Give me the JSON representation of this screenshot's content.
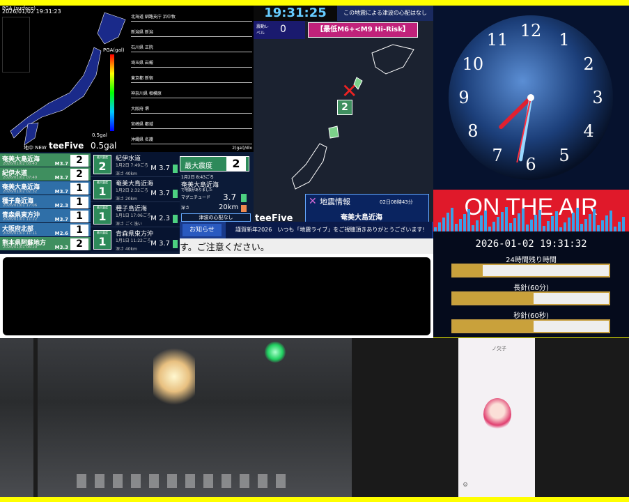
{
  "pga": {
    "title": "PGA (surface)",
    "timestamp": "2026/01/02 19:31:23",
    "scale_label": "PGA(gal)",
    "scale_value": "0.5gal",
    "scale_small": "0.5gal",
    "footer_left": "地中 NEW",
    "brand": "teeFive"
  },
  "waveforms": {
    "stations": [
      "北海道 釧路支庁 浜中牧",
      "新潟県 新潟",
      "石川県 正院",
      "埼玉県 岩槻",
      "東京都 新宿",
      "神奈川県 相模原",
      "大阪府 堺",
      "宮崎県 都城",
      "沖縄県 名護"
    ],
    "footer": "2(gal)/div"
  },
  "eew_header": {
    "time": "19:31:25",
    "tsunami_text": "この地震による津波の心配はなし",
    "level_label": "震動レベル",
    "level_value": "0",
    "risk_text": "【最低M6+<M9 Hi-Risk】"
  },
  "map": {
    "marker_intensity": "2",
    "brand": "teeFive",
    "info_title": "地震情報",
    "info_time": "02日08時43分",
    "info_region": "奄美大島近海"
  },
  "quake_list": [
    {
      "region": "奄美大島近海",
      "datetime": "2026/01/02 08:43",
      "mag": "M3.7",
      "shindo": "2",
      "color": "#3f8f5f"
    },
    {
      "region": "紀伊水道",
      "datetime": "2026/01/02 07:49",
      "mag": "M3.7",
      "shindo": "2",
      "color": "#3f8f5f"
    },
    {
      "region": "奄美大島近海",
      "datetime": "2026/01/02 02:32",
      "mag": "M3.7",
      "shindo": "1",
      "color": "#2f6fa8"
    },
    {
      "region": "種子島近海",
      "datetime": "2026/01/01 17:06",
      "mag": "M2.3",
      "shindo": "1",
      "color": "#2f6fa8"
    },
    {
      "region": "青森県東方沖",
      "datetime": "2026/01/01 11:22",
      "mag": "M3.7",
      "shindo": "1",
      "color": "#2f6fa8"
    },
    {
      "region": "大阪府北部",
      "datetime": "2026/01/01 11:11",
      "mag": "M2.6",
      "shindo": "1",
      "color": "#2f6fa8"
    },
    {
      "region": "熊本県阿蘇地方",
      "datetime": "2026/01/01 06:29",
      "mag": "M3.3",
      "shindo": "2",
      "color": "#3f8f5f"
    }
  ],
  "quake_cards": [
    {
      "badge_label": "最大震度",
      "shindo": "2",
      "place": "紀伊水道",
      "when": "1月2日 7:49ごろ",
      "depth": "深さ 40km",
      "mag": "M 3.7"
    },
    {
      "badge_label": "最大震度",
      "shindo": "1",
      "place": "奄美大島近海",
      "when": "1月2日 2:32ごろ",
      "depth": "深さ 20km",
      "mag": "M 3.7"
    },
    {
      "badge_label": "最大震度",
      "shindo": "1",
      "place": "種子島近海",
      "when": "1月1日 17:06ごろ",
      "depth": "深さ ごく浅い",
      "mag": "M 2.3"
    },
    {
      "badge_label": "最大震度",
      "shindo": "1",
      "place": "青森県東方沖",
      "when": "1月1日 11:22ごろ",
      "depth": "深さ 40km",
      "mag": "M 3.7"
    }
  ],
  "latest": {
    "max_label": "最大震度",
    "max_value": "2",
    "time": "1月2日 8:43ごろ",
    "region": "奄美大島近海",
    "sub": "で地震がありました",
    "mag_label": "マグニチュード",
    "mag_value": "3.7",
    "depth_label": "深さ",
    "depth_value": "20km",
    "tsunami": "津波の心配なし"
  },
  "notice": {
    "label": "お知らせ",
    "text": "謹賀新年2026　いつも「地震ライブ」をご視聴頂きありがとうございます!"
  },
  "ticker": {
    "text": "す。ご注意ください。"
  },
  "clock": {
    "numbers": [
      "12",
      "1",
      "2",
      "3",
      "4",
      "5",
      "6",
      "7",
      "8",
      "9",
      "10",
      "11"
    ],
    "hour": 19,
    "minute": 31,
    "second": 32
  },
  "onair": {
    "title": "ON THE AIR",
    "datetime": "2026-01-02 19:31:32",
    "bars": [
      {
        "label": "24時間残り時間",
        "value": 0.19
      },
      {
        "label": "長針(60分)",
        "value": 0.52
      },
      {
        "label": "秒針(60秒)",
        "value": 0.52
      }
    ]
  },
  "phone": {
    "title": "ノ欠子"
  },
  "colors": {
    "accent": "#ffff00",
    "onair_red": "#e0192a",
    "gold": "#c9a13b"
  }
}
